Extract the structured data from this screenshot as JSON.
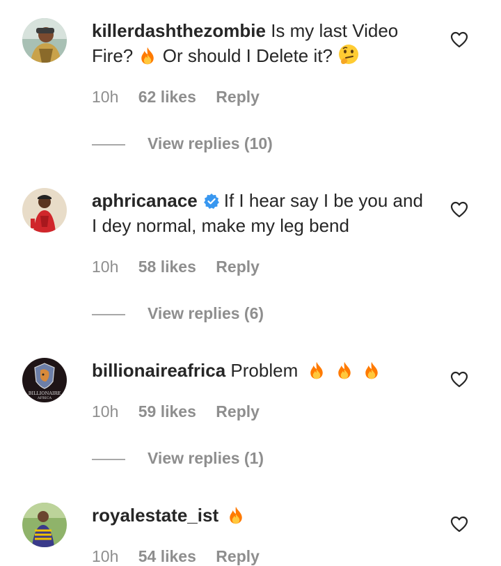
{
  "comments": [
    {
      "username": "killerdashthezombie",
      "text_part1": "Is my last Video Fire?",
      "text_part2": "Or should I Delete it?",
      "time": "10h",
      "likes": "62 likes",
      "reply": "Reply",
      "view_replies": "View replies (10)"
    },
    {
      "username": "aphricanace",
      "verified": true,
      "text": "If I hear say I be you and I dey normal, make my leg bend",
      "time": "10h",
      "likes": "58 likes",
      "reply": "Reply",
      "view_replies": "View replies (6)"
    },
    {
      "username": "billionaireafrica",
      "text": "Problem",
      "avatar_text": "BILLIONAIRE AFRICA",
      "time": "10h",
      "likes": "59 likes",
      "reply": "Reply",
      "view_replies": "View replies (1)"
    },
    {
      "username": "royalestate_ist",
      "text": "",
      "time": "10h",
      "likes": "54 likes",
      "reply": "Reply"
    }
  ],
  "colors": {
    "text": "#262626",
    "meta": "#8e8e8e",
    "verified": "#3897f0",
    "fire": "#ff8c1a"
  },
  "icons": [
    "heart-icon",
    "fire-emoji",
    "thinking-emoji",
    "verified-badge-icon"
  ]
}
